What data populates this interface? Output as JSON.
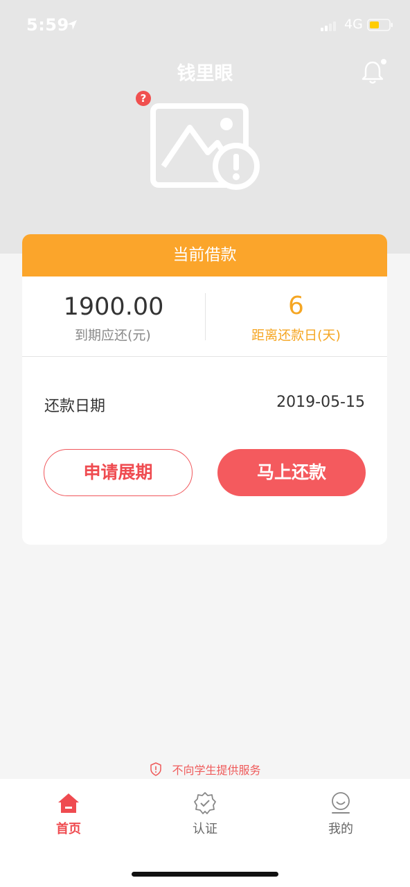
{
  "status_bar": {
    "time": "5:59",
    "network": "4G"
  },
  "header": {
    "title": "钱里眼"
  },
  "loan_card": {
    "title": "当前借款",
    "amount": "1900.00",
    "amount_label": "到期应还(元)",
    "help_badge": "?",
    "days": "6",
    "days_label": "距离还款日(天)",
    "repay_date_label": "还款日期",
    "repay_date": "2019-05-15",
    "extend_button": "申请展期",
    "repay_button": "马上还款"
  },
  "notice": {
    "text": "不向学生提供服务"
  },
  "tabbar": {
    "items": [
      {
        "label": "首页",
        "active": true
      },
      {
        "label": "认证",
        "active": false
      },
      {
        "label": "我的",
        "active": false
      }
    ]
  },
  "colors": {
    "accent_orange": "#fba52b",
    "accent_red": "#f45a5e",
    "header_bg": "#e6e6e6"
  }
}
